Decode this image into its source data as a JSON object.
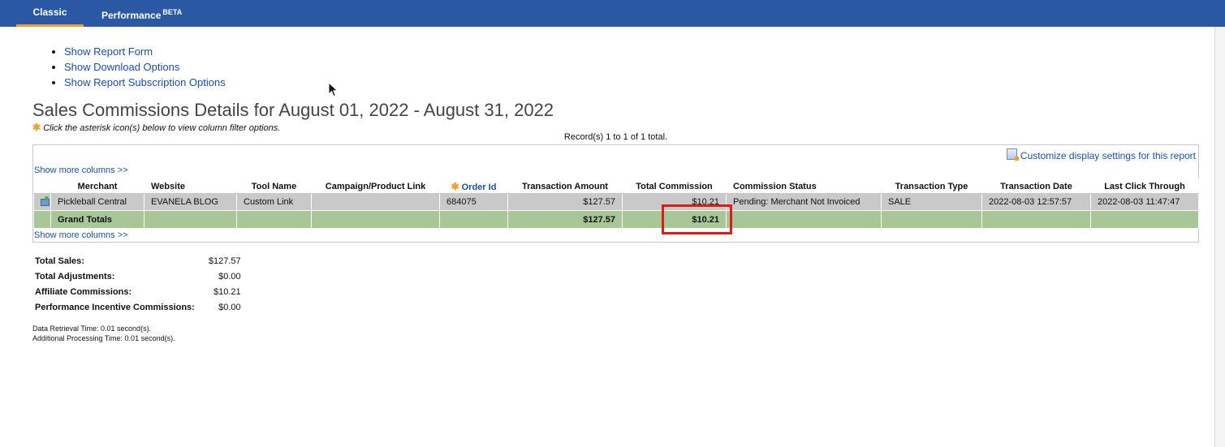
{
  "tabs": {
    "classic": "Classic",
    "performance": "Performance",
    "performance_badge": "BETA"
  },
  "links": [
    "Show Report Form",
    "Show Download Options",
    "Show Report Subscription Options"
  ],
  "report": {
    "title": "Sales Commissions Details for August 01, 2022 - August 31, 2022",
    "hint": "Click the asterisk icon(s) below to view column filter options.",
    "records": "Record(s) 1 to 1 of 1 total.",
    "customize": "Customize display settings for this report",
    "show_more": "Show more columns >>"
  },
  "table": {
    "headers": [
      "",
      "Merchant",
      "Website",
      "Tool Name",
      "Campaign/Product Link",
      "Order Id",
      "Transaction Amount",
      "Total Commission",
      "Commission Status",
      "Transaction Type",
      "Transaction Date",
      "Last Click Through"
    ],
    "row": {
      "merchant": "Pickleball Central",
      "website": "EVANELA BLOG",
      "tool": "Custom Link",
      "campaign": "",
      "order_id": "684075",
      "amount": "$127.57",
      "commission": "$10.21",
      "status": "Pending: Merchant Not Invoiced",
      "type": "SALE",
      "date": "2022-08-03 12:57:57",
      "last_click": "2022-08-03 11:47:47"
    },
    "totals": {
      "label": "Grand Totals",
      "amount": "$127.57",
      "commission": "$10.21"
    }
  },
  "summary": [
    {
      "label": "Total Sales:",
      "value": "$127.57"
    },
    {
      "label": "Total Adjustments:",
      "value": "$0.00"
    },
    {
      "label": "Affiliate Commissions:",
      "value": "$10.21"
    },
    {
      "label": "Performance Incentive Commissions:",
      "value": "$0.00"
    }
  ],
  "timing": {
    "retrieval": "Data Retrieval Time: 0.01 second(s).",
    "processing": "Additional Processing Time: 0.01 second(s)."
  },
  "colors": {
    "topbar": "#2b58a5",
    "tab_accent": "#f0a02a",
    "link": "#1a4fa8",
    "totals_row": "#a7c896",
    "data_row": "#c9c9c9",
    "highlight": "#e01b1b"
  }
}
